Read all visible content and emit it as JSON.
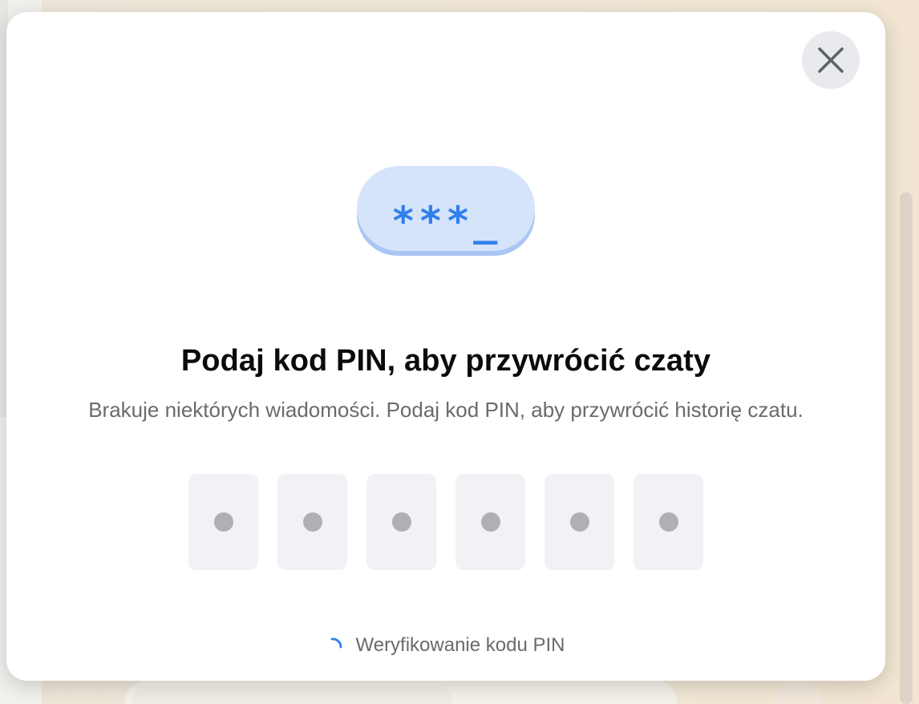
{
  "dialog": {
    "close_icon": "close-icon",
    "illustration": {
      "text": "***_",
      "icon": "pin-code-bubble-icon",
      "colors": {
        "fill": "#d6e4fb",
        "shadow": "#a9c6f5",
        "text": "#2f80ec"
      }
    },
    "title": "Podaj kod PIN, aby przywrócić czaty",
    "subtitle": "Brakuje niektórych wiadomości. Podaj kod PIN, aby przywrócić historię czatu.",
    "pin_fields": [
      {
        "value": "",
        "state": "filled-dot"
      },
      {
        "value": "",
        "state": "filled-dot"
      },
      {
        "value": "",
        "state": "filled-dot"
      },
      {
        "value": "",
        "state": "filled-dot"
      },
      {
        "value": "",
        "state": "filled-dot"
      },
      {
        "value": "",
        "state": "filled-dot"
      }
    ],
    "status": {
      "icon": "spinner-icon",
      "text": "Weryfikowanie kodu PIN",
      "accent": "#2f80ec"
    }
  },
  "colors": {
    "modal_bg": "#ffffff",
    "title": "#0b0b0b",
    "secondary_text": "#6a6a6f",
    "pin_cell_bg": "#f1f2f6",
    "pin_dot": "#afb0b3",
    "close_button_bg": "#e9eaed"
  }
}
